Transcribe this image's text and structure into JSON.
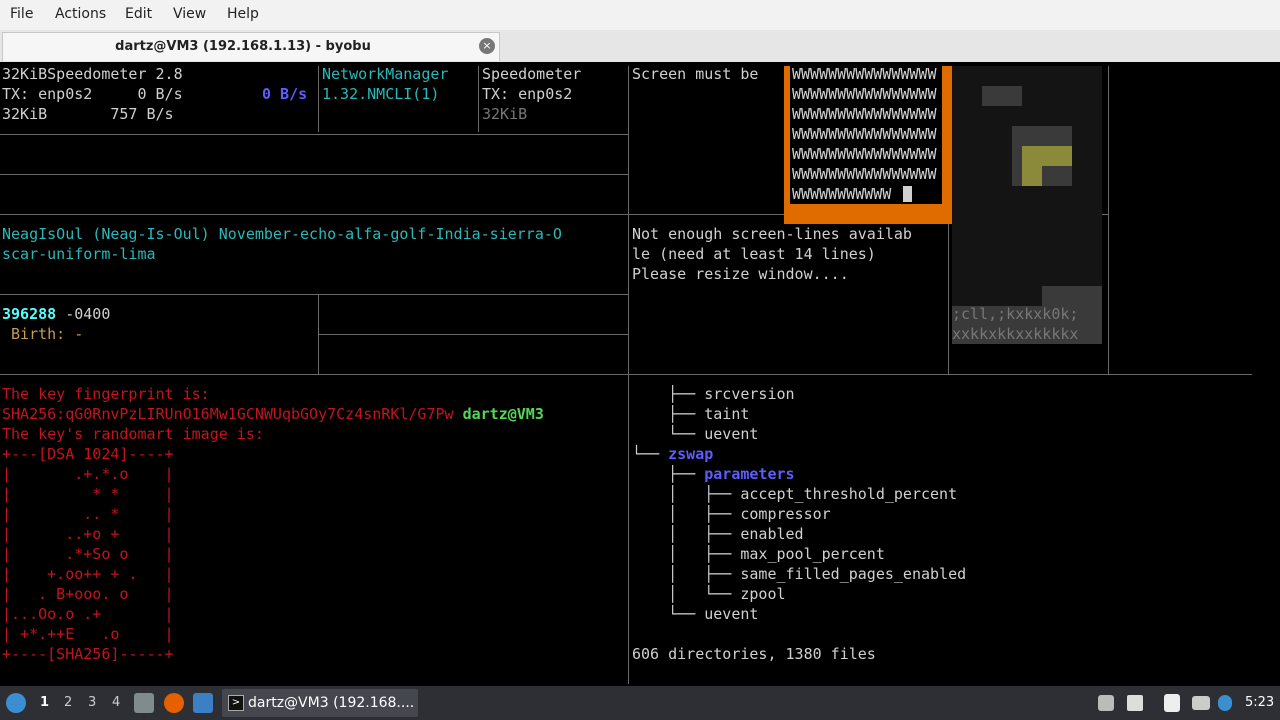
{
  "menu": [
    "File",
    "Actions",
    "Edit",
    "View",
    "Help"
  ],
  "tab": {
    "title": "dartz@VM3 (192.168.1.13) - byobu",
    "close": "×"
  },
  "panes": {
    "speedo1": [
      "32KiBSpeedometer 2.8",
      "TX: enp0s2     0 B/s",
      "0 B/s",
      "32KiB       757 B/s"
    ],
    "nm": [
      "NetworkManager",
      "1.32.NMCLI(1)"
    ],
    "speedo2": [
      "Speedometer",
      "TX: enp0s2",
      "32KiB"
    ],
    "screen_msg": "Screen must be",
    "w_lines": [
      "WWWWWWWWWWWWWWWW",
      "WWWWWWWWWWWWWWWW",
      "WWWWWWWWWWWWWWWW",
      "WWWWWWWWWWWWWWWW",
      "WWWWWWWWWWWWWWWW",
      "WWWWWWWWWWWWWWWW",
      "WWWWWWWWWWW"
    ],
    "neag": [
      "NeagIsOul (Neag-Is-Oul) November-echo-alfa-golf-India-sierra-O",
      "scar-uniform-lima"
    ],
    "not_enough": [
      "Not enough screen-lines availab",
      "le (need at least 14 lines)",
      "Please resize window...."
    ],
    "art_text": [
      ";cll,;kxkxk0k;",
      "xxkkxkkxxkkkkx"
    ],
    "stat": {
      "inode": "396288",
      "tz": " -0400",
      "birth": " Birth: -"
    },
    "ssh": {
      "fp_title": "The key fingerprint is:",
      "fp": "SHA256:qG0RnvPzLIRUnO16Mw1GCNWUqbGOy7Cz4snRKl/G7Pw",
      "user": "dartz@VM3",
      "rand_title": "The key's randomart image is:",
      "art": [
        "+---[DSA 1024]----+",
        "|       .+.*.o    |",
        "|         * *     |",
        "|        .. *     |",
        "|      ..+o +     |",
        "|      .*+So o    |",
        "|    +.oo++ + .   |",
        "|   . B+ooo. o    |",
        "|...Oo.o .+       |",
        "| +*.++E   .o     |",
        "+----[SHA256]-----+"
      ]
    },
    "tree": {
      "lines": [
        {
          "prefix": "    ├── ",
          "name": "srcversion",
          "style": "w"
        },
        {
          "prefix": "    ├── ",
          "name": "taint",
          "style": "w"
        },
        {
          "prefix": "    └── ",
          "name": "uevent",
          "style": "w"
        },
        {
          "prefix": "└── ",
          "name": "zswap",
          "style": "bl"
        },
        {
          "prefix": "    ├── ",
          "name": "parameters",
          "style": "bl"
        },
        {
          "prefix": "    │   ├── ",
          "name": "accept_threshold_percent",
          "style": "w"
        },
        {
          "prefix": "    │   ├── ",
          "name": "compressor",
          "style": "w"
        },
        {
          "prefix": "    │   ├── ",
          "name": "enabled",
          "style": "w"
        },
        {
          "prefix": "    │   ├── ",
          "name": "max_pool_percent",
          "style": "w"
        },
        {
          "prefix": "    │   ├── ",
          "name": "same_filled_pages_enabled",
          "style": "w"
        },
        {
          "prefix": "    │   └── ",
          "name": "zpool",
          "style": "w"
        },
        {
          "prefix": "    └── ",
          "name": "uevent",
          "style": "w"
        }
      ],
      "summary": "606 directories, 1380 files"
    }
  },
  "taskbar": {
    "workspaces": [
      "1",
      "2",
      "3",
      "4"
    ],
    "task_label": "dartz@VM3 (192.168....",
    "clock": "5:23",
    "colors": {
      "bg": "#2d2f34",
      "firefox": "#e66000",
      "folder": "#7f8c8d"
    }
  }
}
